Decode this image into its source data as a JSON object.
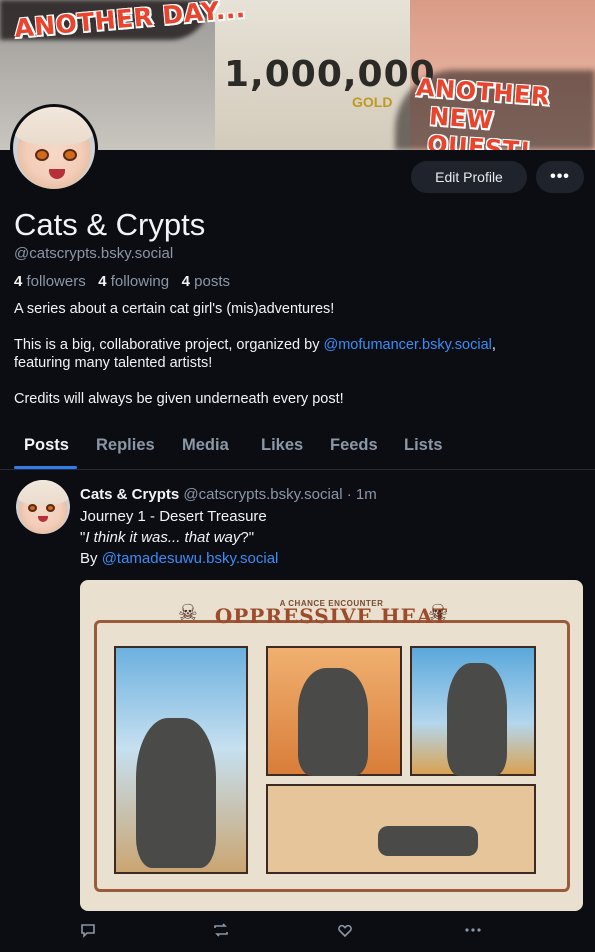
{
  "banner": {
    "headline_left": "ANOTHER DAY...",
    "headline_right_1": "ANOTHER",
    "headline_right_2": "NEW QUEST!",
    "center_number": "1,000,000",
    "center_word": "GOLD"
  },
  "profile": {
    "edit_label": "Edit Profile",
    "more_label": "•••",
    "display_name": "Cats & Crypts",
    "handle": "@catscrypts.bsky.social",
    "followers_count": "4",
    "followers_label": "followers",
    "following_count": "4",
    "following_label": "following",
    "posts_count": "4",
    "posts_label": "posts",
    "bio_line1": "A series about a certain cat girl's (mis)adventures!",
    "bio_line2_a": "This is a big, collaborative project, organized by ",
    "bio_line2_link": "@mofumancer.bsky.social",
    "bio_line2_b": ",",
    "bio_line2_c": "featuring many talented artists!",
    "bio_line3": "Credits will always be given underneath every post!"
  },
  "tabs": [
    "Posts",
    "Replies",
    "Media",
    "Likes",
    "Feeds",
    "Lists"
  ],
  "post": {
    "author": "Cats & Crypts",
    "handle_time": "@catscrypts.bsky.social · 1m",
    "line1": "Journey 1 - Desert Treasure",
    "line2_quote_open": "\"",
    "line2_italic": "I think it was... that way",
    "line2_quote_close": "?\"",
    "line3_prefix": "By ",
    "line3_link": "@tamadesuwu.bsky.social",
    "image_subtitle": "A CHANCE ENCOUNTER",
    "image_title": "OPPRESSIVE HEAT"
  },
  "actions": {
    "reply_icon": "reply-icon",
    "repost_icon": "repost-icon",
    "like_icon": "like-icon",
    "more_icon": "more-icon"
  }
}
